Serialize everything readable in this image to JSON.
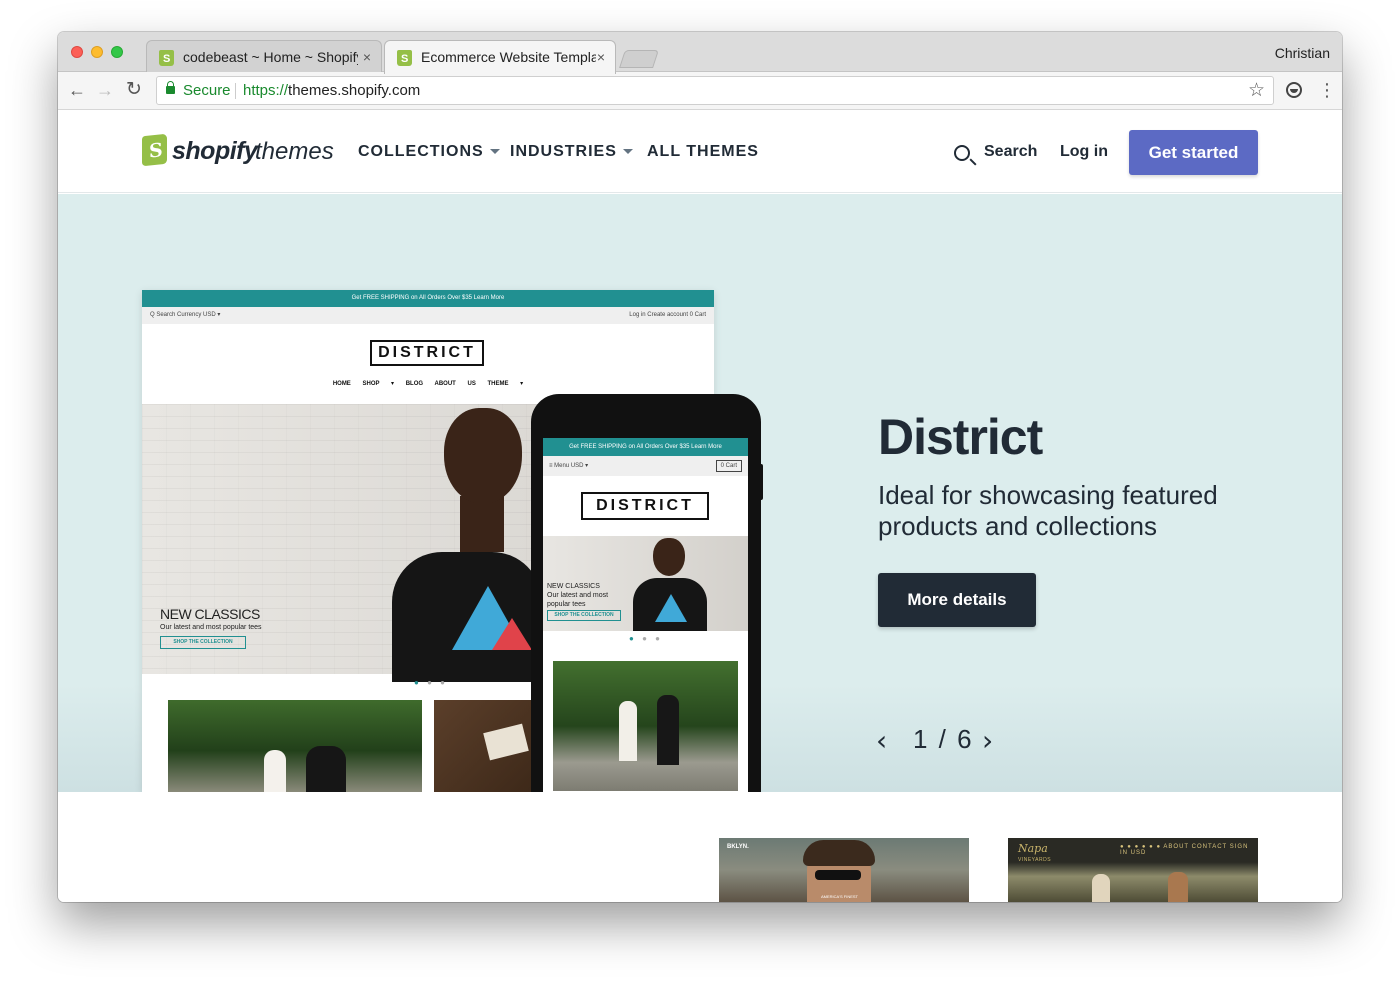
{
  "browser": {
    "tabs": [
      {
        "title": "codebeast ~ Home ~ Shopify",
        "active": false
      },
      {
        "title": "Ecommerce Website Template",
        "active": true
      }
    ],
    "close_glyph": "×",
    "profile_name": "Christian",
    "secure_label": "Secure",
    "url_protocol": "https://",
    "url_host": "themes.shopify.com",
    "icons": {
      "back": "arrow-left-icon",
      "forward": "arrow-right-icon",
      "reload": "reload-icon",
      "bookmark": "star-icon",
      "extension": "extension-icon",
      "menu": "kebab-menu-icon"
    }
  },
  "site": {
    "logo_text": "shopify",
    "logo_suffix": "themes",
    "nav": [
      {
        "label": "COLLECTIONS",
        "has_dropdown": true
      },
      {
        "label": "INDUSTRIES",
        "has_dropdown": true
      },
      {
        "label": "ALL THEMES",
        "has_dropdown": false
      }
    ],
    "search_label": "Search",
    "login_label": "Log in",
    "cta_label": "Get started",
    "colors": {
      "cta": "#5c6ac4",
      "ink": "#212b36",
      "hero_bg": "#dceded",
      "theme_teal": "#219091",
      "brand_green": "#95bf47"
    }
  },
  "hero": {
    "title": "District",
    "description": "Ideal for showcasing featured products and collections",
    "button_label": "More details",
    "pager": {
      "current": 1,
      "total": 6,
      "text": "1 / 6",
      "prev_glyph": "‹",
      "next_glyph": "›"
    }
  },
  "preview": {
    "announcement": "Get FREE SHIPPING on All Orders Over $35 Learn More",
    "topbar_left": "Q Search    Currency  USD ▾",
    "topbar_right": "Log in    Create account    0 Cart",
    "logo": "DISTRICT",
    "menu": "HOME  SHOP ▾  BLOG  ABOUT US  THEME ▾",
    "slide_title": "NEW CLASSICS",
    "slide_subtitle": "Our latest and most popular tees",
    "slide_button": "SHOP THE COLLECTION",
    "dots": "● ● ●",
    "mobile": {
      "announcement": "Get FREE SHIPPING on All Orders Over $35 Learn More",
      "topbar_left": "≡ Menu    USD ▾",
      "topbar_right": "0 Cart",
      "logo": "DISTRICT",
      "slide_title": "NEW CLASSICS",
      "slide_subtitle_1": "Our latest and most",
      "slide_subtitle_2": "popular tees",
      "slide_button": "SHOP THE COLLECTION",
      "dots": "● ● ●"
    }
  },
  "thumbnails": [
    {
      "brand": "BKLYN.",
      "tagline": "AMERICA'S FINEST"
    },
    {
      "brand": "Napa",
      "brand_sub": "VINEYARDS",
      "nav": "● ● ● ● ● ●  ABOUT  CONTACT  SIGN IN  USD"
    }
  ]
}
